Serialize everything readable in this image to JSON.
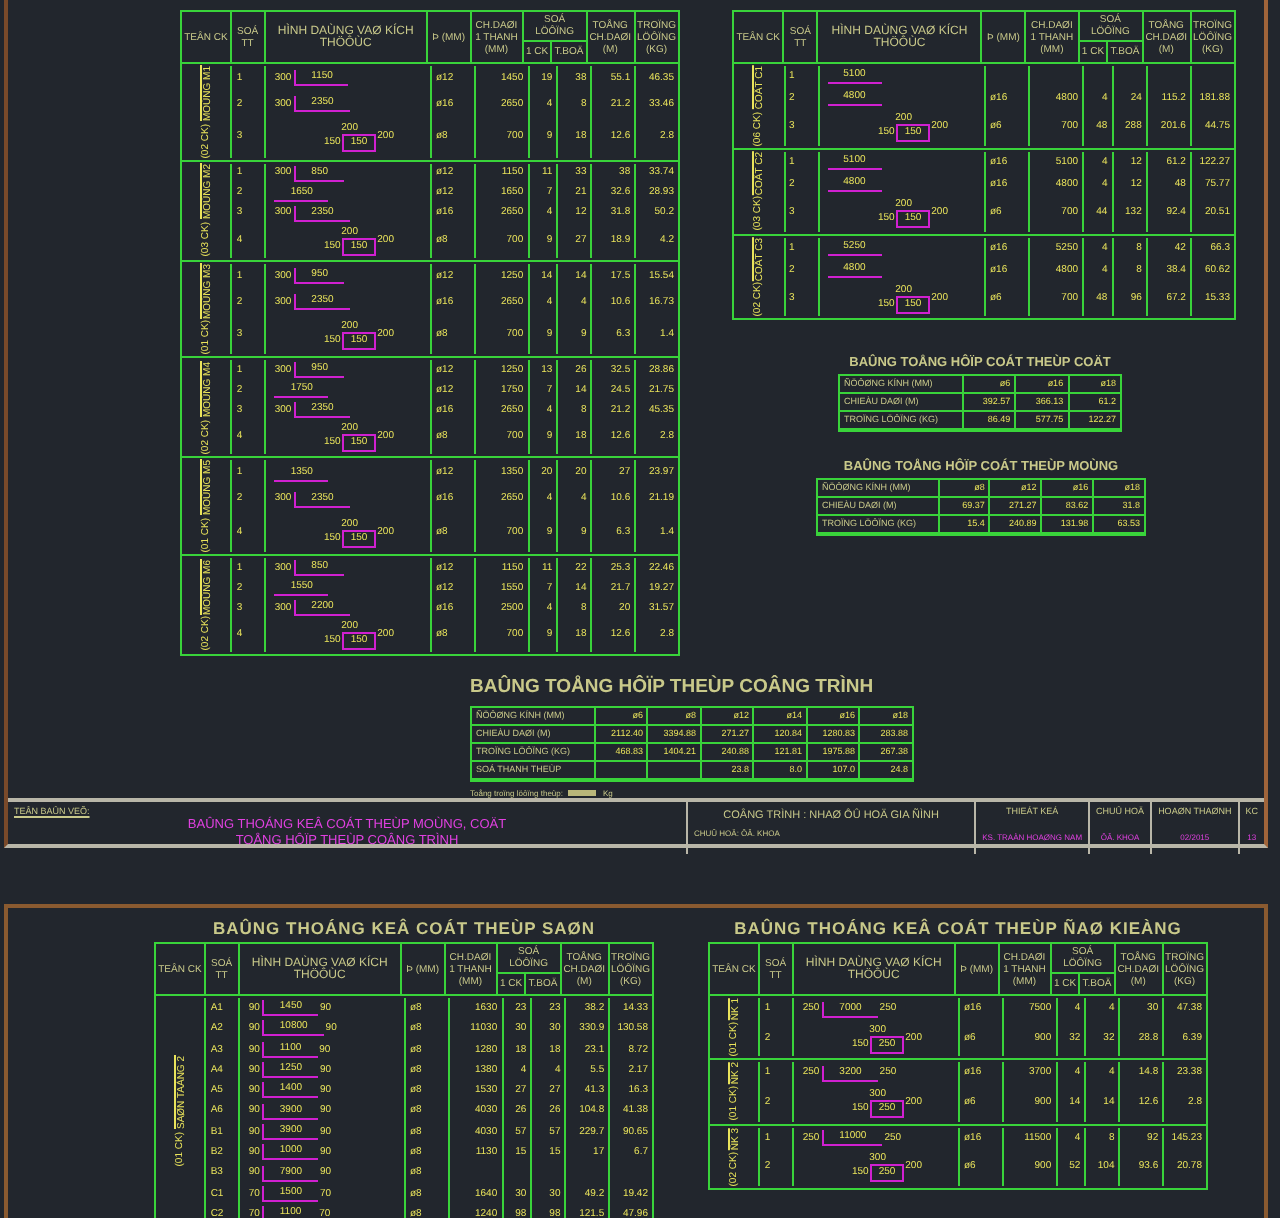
{
  "beam_schedule": {
    "header": {
      "name": "TEÂN CK",
      "no": "SOÁ TT",
      "shape": "HÌNH DAÙNG VAØ KÍCH THÖÔÙC",
      "dia": "Þ (MM)",
      "length": "CH.DAØI 1 THANH (MM)",
      "qty": "SOÁ LÖÔÏNG",
      "qty_each": "1 CK",
      "qty_total": "T.BOÄ",
      "total_length": "TOÅNG CH.DAØI (M)",
      "weight": "TROÏNG LÖÔÏNG (KG)"
    },
    "groups": [
      {
        "name": "MOÙNG M1",
        "count": "(02 CK)",
        "rows": [
          {
            "no": "1",
            "kind": "bar",
            "dims": [
              "300",
              "1150"
            ],
            "dia": "ø12",
            "length": "1450",
            "qty_each": "19",
            "qty_total": "38",
            "total_length": "55.1",
            "weight": "46.35"
          },
          {
            "no": "2",
            "kind": "bar",
            "dims": [
              "300",
              "2350"
            ],
            "dia": "ø16",
            "length": "2650",
            "qty_each": "4",
            "qty_total": "8",
            "total_length": "21.2",
            "weight": "33.46"
          },
          {
            "no": "3",
            "kind": "stirrup",
            "dims": [
              "200",
              "150",
              "150",
              "200"
            ],
            "dia": "ø8",
            "length": "700",
            "qty_each": "9",
            "qty_total": "18",
            "total_length": "12.6",
            "weight": "2.8"
          }
        ]
      },
      {
        "name": "MOÙNG M2",
        "count": "(03 CK)",
        "rows": [
          {
            "no": "1",
            "kind": "bar",
            "dims": [
              "300",
              "850"
            ],
            "dia": "ø12",
            "length": "1150",
            "qty_each": "11",
            "qty_total": "33",
            "total_length": "38",
            "weight": "33.74"
          },
          {
            "no": "2",
            "kind": "bar",
            "dims": [
              "1650"
            ],
            "dia": "ø12",
            "length": "1650",
            "qty_each": "7",
            "qty_total": "21",
            "total_length": "32.6",
            "weight": "28.93"
          },
          {
            "no": "3",
            "kind": "bar",
            "dims": [
              "300",
              "2350"
            ],
            "dia": "ø16",
            "length": "2650",
            "qty_each": "4",
            "qty_total": "12",
            "total_length": "31.8",
            "weight": "50.2"
          },
          {
            "no": "4",
            "kind": "stirrup",
            "dims": [
              "200",
              "150",
              "150",
              "200"
            ],
            "dia": "ø8",
            "length": "700",
            "qty_each": "9",
            "qty_total": "27",
            "total_length": "18.9",
            "weight": "4.2"
          }
        ]
      },
      {
        "name": "MOÙNG M3",
        "count": "(01 CK)",
        "rows": [
          {
            "no": "1",
            "kind": "bar",
            "dims": [
              "300",
              "950"
            ],
            "dia": "ø12",
            "length": "1250",
            "qty_each": "14",
            "qty_total": "14",
            "total_length": "17.5",
            "weight": "15.54"
          },
          {
            "no": "2",
            "kind": "bar",
            "dims": [
              "300",
              "2350"
            ],
            "dia": "ø16",
            "length": "2650",
            "qty_each": "4",
            "qty_total": "4",
            "total_length": "10.6",
            "weight": "16.73"
          },
          {
            "no": "3",
            "kind": "stirrup",
            "dims": [
              "200",
              "150",
              "150",
              "200"
            ],
            "dia": "ø8",
            "length": "700",
            "qty_each": "9",
            "qty_total": "9",
            "total_length": "6.3",
            "weight": "1.4"
          }
        ]
      },
      {
        "name": "MOÙNG M4",
        "count": "(02 CK)",
        "rows": [
          {
            "no": "1",
            "kind": "bar",
            "dims": [
              "300",
              "950"
            ],
            "dia": "ø12",
            "length": "1250",
            "qty_each": "13",
            "qty_total": "26",
            "total_length": "32.5",
            "weight": "28.86"
          },
          {
            "no": "2",
            "kind": "bar",
            "dims": [
              "1750"
            ],
            "dia": "ø12",
            "length": "1750",
            "qty_each": "7",
            "qty_total": "14",
            "total_length": "24.5",
            "weight": "21.75"
          },
          {
            "no": "3",
            "kind": "bar",
            "dims": [
              "300",
              "2350"
            ],
            "dia": "ø16",
            "length": "2650",
            "qty_each": "4",
            "qty_total": "8",
            "total_length": "21.2",
            "weight": "45.35"
          },
          {
            "no": "4",
            "kind": "stirrup",
            "dims": [
              "200",
              "150",
              "150",
              "200"
            ],
            "dia": "ø8",
            "length": "700",
            "qty_each": "9",
            "qty_total": "18",
            "total_length": "12.6",
            "weight": "2.8"
          }
        ]
      },
      {
        "name": "MOÙNG M5",
        "count": "(01 CK)",
        "rows": [
          {
            "no": "1",
            "kind": "bar",
            "dims": [
              "1350"
            ],
            "dia": "ø12",
            "length": "1350",
            "qty_each": "20",
            "qty_total": "20",
            "total_length": "27",
            "weight": "23.97"
          },
          {
            "no": "2",
            "kind": "bar",
            "dims": [
              "300",
              "2350"
            ],
            "dia": "ø16",
            "length": "2650",
            "qty_each": "4",
            "qty_total": "4",
            "total_length": "10.6",
            "weight": "21.19"
          },
          {
            "no": "4",
            "kind": "stirrup",
            "dims": [
              "200",
              "150",
              "150",
              "200"
            ],
            "dia": "ø8",
            "length": "700",
            "qty_each": "9",
            "qty_total": "9",
            "total_length": "6.3",
            "weight": "1.4"
          }
        ]
      },
      {
        "name": "MOÙNG M6",
        "count": "(02 CK)",
        "rows": [
          {
            "no": "1",
            "kind": "bar",
            "dims": [
              "300",
              "850"
            ],
            "dia": "ø12",
            "length": "1150",
            "qty_each": "11",
            "qty_total": "22",
            "total_length": "25.3",
            "weight": "22.46"
          },
          {
            "no": "2",
            "kind": "bar",
            "dims": [
              "1550"
            ],
            "dia": "ø12",
            "length": "1550",
            "qty_each": "7",
            "qty_total": "14",
            "total_length": "21.7",
            "weight": "19.27"
          },
          {
            "no": "3",
            "kind": "bar",
            "dims": [
              "300",
              "2200"
            ],
            "dia": "ø16",
            "length": "2500",
            "qty_each": "4",
            "qty_total": "8",
            "total_length": "20",
            "weight": "31.57"
          },
          {
            "no": "4",
            "kind": "stirrup",
            "dims": [
              "200",
              "150",
              "150",
              "200"
            ],
            "dia": "ø8",
            "length": "700",
            "qty_each": "9",
            "qty_total": "18",
            "total_length": "12.6",
            "weight": "2.8"
          }
        ]
      }
    ]
  },
  "column_schedule": {
    "header": {
      "name": "TEÂN CK",
      "no": "SOÁ TT",
      "shape": "HÌNH DAÙNG VAØ KÍCH THÖÔÙC",
      "dia": "Þ (MM)",
      "length": "CH.DAØI 1 THANH (MM)",
      "qty": "SOÁ LÖÔÏNG",
      "qty_each": "1 CK",
      "qty_total": "T.BOÄ",
      "total_length": "TOÅNG CH.DAØI (M)",
      "weight": "TROÏNG LÖÔÏNG (KG)"
    },
    "groups": [
      {
        "name": "COÄT C1",
        "count": "(06 CK)",
        "rows": [
          {
            "no": "1",
            "kind": "bar",
            "dims": [
              "5100"
            ]
          },
          {
            "no": "2",
            "kind": "bar",
            "dims": [
              "4800"
            ],
            "dia": "ø16",
            "length": "4800",
            "qty_each": "4",
            "qty_total": "24",
            "total_length": "115.2",
            "weight": "181.88"
          },
          {
            "no": "3",
            "kind": "stirrup",
            "dims": [
              "200",
              "150",
              "150",
              "200"
            ],
            "dia": "ø6",
            "length": "700",
            "qty_each": "48",
            "qty_total": "288",
            "total_length": "201.6",
            "weight": "44.75"
          }
        ]
      },
      {
        "name": "COÄT C2",
        "count": "(03 CK)",
        "rows": [
          {
            "no": "1",
            "kind": "bar",
            "dims": [
              "5100"
            ],
            "dia": "ø16",
            "length": "5100",
            "qty_each": "4",
            "qty_total": "12",
            "total_length": "61.2",
            "weight": "122.27"
          },
          {
            "no": "2",
            "kind": "bar",
            "dims": [
              "4800"
            ],
            "dia": "ø16",
            "length": "4800",
            "qty_each": "4",
            "qty_total": "12",
            "total_length": "48",
            "weight": "75.77"
          },
          {
            "no": "3",
            "kind": "stirrup",
            "dims": [
              "200",
              "150",
              "150",
              "200"
            ],
            "dia": "ø6",
            "length": "700",
            "qty_each": "44",
            "qty_total": "132",
            "total_length": "92.4",
            "weight": "20.51"
          }
        ]
      },
      {
        "name": "COÄT C3",
        "count": "(02 CK)",
        "rows": [
          {
            "no": "1",
            "kind": "bar",
            "dims": [
              "5250"
            ],
            "dia": "ø16",
            "length": "5250",
            "qty_each": "4",
            "qty_total": "8",
            "total_length": "42",
            "weight": "66.3"
          },
          {
            "no": "2",
            "kind": "bar",
            "dims": [
              "4800"
            ],
            "dia": "ø16",
            "length": "4800",
            "qty_each": "4",
            "qty_total": "8",
            "total_length": "38.4",
            "weight": "60.62"
          },
          {
            "no": "3",
            "kind": "stirrup",
            "dims": [
              "200",
              "150",
              "150",
              "200"
            ],
            "dia": "ø6",
            "length": "700",
            "qty_each": "48",
            "qty_total": "96",
            "total_length": "67.2",
            "weight": "15.33"
          }
        ]
      }
    ]
  },
  "column_summary": {
    "title": "BAÛNG TOÅNG HÔÏP COÁT THEÙP COÄT",
    "rows": [
      {
        "label": "ÑÖÔØNG KÍNH (MM)",
        "cells": [
          "ø6",
          "ø16",
          "ø18"
        ]
      },
      {
        "label": "CHIEÀU DAØI (M)",
        "cells": [
          "392.57",
          "366.13",
          "61.2"
        ]
      },
      {
        "label": "TROÏNG LÖÔÏNG (KG)",
        "cells": [
          "86.49",
          "577.75",
          "122.27"
        ]
      }
    ]
  },
  "foundation_summary": {
    "title": "BAÛNG TOÅNG HÔÏP COÁT THEÙP MOÙNG",
    "rows": [
      {
        "label": "ÑÖÔØNG KÍNH (MM)",
        "cells": [
          "ø8",
          "ø12",
          "ø16",
          "ø18"
        ]
      },
      {
        "label": "CHIEÀU DAØI (M)",
        "cells": [
          "69.37",
          "271.27",
          "83.62",
          "31.8"
        ]
      },
      {
        "label": "TROÏNG LÖÔÏNG (KG)",
        "cells": [
          "15.4",
          "240.89",
          "131.98",
          "63.53"
        ]
      }
    ]
  },
  "project_summary": {
    "title": "BAÛNG TOÅNG HÔÏP THEÙP COÂNG TRÌNH",
    "rows": [
      {
        "label": "ÑÖÔØNG KÍNH (MM)",
        "cells": [
          "ø6",
          "ø8",
          "ø12",
          "ø14",
          "ø16",
          "ø18"
        ]
      },
      {
        "label": "CHIEÀU DAØI (M)",
        "cells": [
          "2112.40",
          "3394.88",
          "271.27",
          "120.84",
          "1280.83",
          "283.88"
        ]
      },
      {
        "label": "TROÏNG LÖÔÏNG (KG)",
        "cells": [
          "468.83",
          "1404.21",
          "240.88",
          "121.81",
          "1975.88",
          "267.38"
        ]
      },
      {
        "label": "SOÁ THANH THEÙP",
        "cells": [
          "",
          "",
          "23.8",
          "8.0",
          "107.0",
          "24.8"
        ]
      }
    ],
    "note": "Toång troïng löôïng theùp:",
    "unit": "Kg"
  },
  "title_block": {
    "label": "TEÂN BAÛN VEÕ:",
    "title_lines": [
      "BAÛNG THOÁNG KEÂ COÁT THEÙP MOÙNG, COÄT",
      "TOÅNG HÔÏP THEÙP COÂNG TRÌNH"
    ],
    "project": "COÂNG TRÌNH : NHAØ ÔÛ HOÄ GIA ÑÌNH",
    "owner": "CHUÛ HOÄ: ÔÂ. KHOA",
    "fields": [
      {
        "heading": "THIEÁT KEÁ",
        "value": "KS. TRAÀN HOAØNG NAM"
      },
      {
        "heading": "CHUÛ HOÄ",
        "value": "ÔÂ. KHOA"
      },
      {
        "heading": "HOAØN THAØNH",
        "value": "02/2015"
      },
      {
        "heading": "KC",
        "value": "13"
      }
    ]
  },
  "slab_schedule": {
    "title": "BAÛNG THOÁNG KEÂ COÁT THEÙP SAØN",
    "header": {
      "name": "TEÂN CK",
      "no": "SOÁ TT",
      "shape": "HÌNH DAÙNG VAØ KÍCH THÖÔÙC",
      "dia": "Þ (MM)",
      "length": "CH.DAØI 1 THANH (MM)",
      "qty": "SOÁ LÖÔÏNG",
      "qty_each": "1 CK",
      "qty_total": "T.BOÄ",
      "total_length": "TOÅNG CH.DAØI (M)",
      "weight": "TROÏNG LÖÔÏNG (KG)"
    },
    "groups": [
      {
        "name": "SAØN TAÀNG 2",
        "count": "(01 CK)",
        "rows": [
          {
            "no": "A1",
            "kind": "bar",
            "dims": [
              "90",
              "1450",
              "90"
            ],
            "dia": "ø8",
            "length": "1630",
            "qty_each": "23",
            "qty_total": "23",
            "total_length": "38.2",
            "weight": "14.33"
          },
          {
            "no": "A2",
            "kind": "bar",
            "dims": [
              "90",
              "10800",
              "90"
            ],
            "dia": "ø8",
            "length": "11030",
            "qty_each": "30",
            "qty_total": "30",
            "total_length": "330.9",
            "weight": "130.58"
          },
          {
            "no": "A3",
            "kind": "bar",
            "dims": [
              "90",
              "1100",
              "90"
            ],
            "dia": "ø8",
            "length": "1280",
            "qty_each": "18",
            "qty_total": "18",
            "total_length": "23.1",
            "weight": "8.72"
          },
          {
            "no": "A4",
            "kind": "bar",
            "dims": [
              "90",
              "1250",
              "90"
            ],
            "dia": "ø8",
            "length": "1380",
            "qty_each": "4",
            "qty_total": "4",
            "total_length": "5.5",
            "weight": "2.17"
          },
          {
            "no": "A5",
            "kind": "bar",
            "dims": [
              "90",
              "1400",
              "90"
            ],
            "dia": "ø8",
            "length": "1530",
            "qty_each": "27",
            "qty_total": "27",
            "total_length": "41.3",
            "weight": "16.3"
          },
          {
            "no": "A6",
            "kind": "bar",
            "dims": [
              "90",
              "3900",
              "90"
            ],
            "dia": "ø8",
            "length": "4030",
            "qty_each": "26",
            "qty_total": "26",
            "total_length": "104.8",
            "weight": "41.38"
          },
          {
            "no": "B1",
            "kind": "bar",
            "dims": [
              "90",
              "3900",
              "90"
            ],
            "dia": "ø8",
            "length": "4030",
            "qty_each": "57",
            "qty_total": "57",
            "total_length": "229.7",
            "weight": "90.65"
          },
          {
            "no": "B2",
            "kind": "bar",
            "dims": [
              "90",
              "1000",
              "90"
            ],
            "dia": "ø8",
            "length": "1130",
            "qty_each": "15",
            "qty_total": "15",
            "total_length": "17",
            "weight": "6.7"
          },
          {
            "no": "B3",
            "kind": "bar",
            "dims": [
              "90",
              "7900",
              "90"
            ],
            "dia": "ø8"
          },
          {
            "no": "C1",
            "kind": "bar",
            "dims": [
              "70",
              "1500",
              "70"
            ],
            "dia": "ø8",
            "length": "1640",
            "qty_each": "30",
            "qty_total": "30",
            "total_length": "49.2",
            "weight": "19.42"
          },
          {
            "no": "C2",
            "kind": "bar",
            "dims": [
              "70",
              "1100",
              "70"
            ],
            "dia": "ø8",
            "length": "1240",
            "qty_each": "98",
            "qty_total": "98",
            "total_length": "121.5",
            "weight": "47.96"
          }
        ]
      }
    ]
  },
  "tie_beam_schedule": {
    "title": "BAÛNG THOÁNG KEÂ COÁT THEÙP ÑAØ KIEÀNG",
    "header": {
      "name": "TEÂN CK",
      "no": "SOÁ TT",
      "shape": "HÌNH DAÙNG VAØ KÍCH THÖÔÙC",
      "dia": "Þ (MM)",
      "length": "CH.DAØI 1 THANH (MM)",
      "qty": "SOÁ LÖÔÏNG",
      "qty_each": "1 CK",
      "qty_total": "T.BOÄ",
      "total_length": "TOÅNG CH.DAØI (M)",
      "weight": "TROÏNG LÖÔÏNG (KG)"
    },
    "groups": [
      {
        "name": "ÑK 1",
        "count": "(01 CK)",
        "rows": [
          {
            "no": "1",
            "kind": "bar",
            "dims": [
              "250",
              "7000",
              "250"
            ],
            "dia": "ø16",
            "length": "7500",
            "qty_each": "4",
            "qty_total": "4",
            "total_length": "30",
            "weight": "47.38"
          },
          {
            "no": "2",
            "kind": "stirrup",
            "dims": [
              "300",
              "150",
              "250",
              "200"
            ],
            "dia": "ø6",
            "length": "900",
            "qty_each": "32",
            "qty_total": "32",
            "total_length": "28.8",
            "weight": "6.39"
          }
        ]
      },
      {
        "name": "ÑK 2",
        "count": "(01 CK)",
        "rows": [
          {
            "no": "1",
            "kind": "bar",
            "dims": [
              "250",
              "3200",
              "250"
            ],
            "dia": "ø16",
            "length": "3700",
            "qty_each": "4",
            "qty_total": "4",
            "total_length": "14.8",
            "weight": "23.38"
          },
          {
            "no": "2",
            "kind": "stirrup",
            "dims": [
              "300",
              "150",
              "250",
              "200"
            ],
            "dia": "ø6",
            "length": "900",
            "qty_each": "14",
            "qty_total": "14",
            "total_length": "12.6",
            "weight": "2.8"
          }
        ]
      },
      {
        "name": "ÑK 3",
        "count": "(02 CK)",
        "rows": [
          {
            "no": "1",
            "kind": "bar",
            "dims": [
              "250",
              "11000",
              "250"
            ],
            "dia": "ø16",
            "length": "11500",
            "qty_each": "4",
            "qty_total": "8",
            "total_length": "92",
            "weight": "145.23"
          },
          {
            "no": "2",
            "kind": "stirrup",
            "dims": [
              "300",
              "150",
              "250",
              "200"
            ],
            "dia": "ø6",
            "length": "900",
            "qty_each": "52",
            "qty_total": "104",
            "total_length": "93.6",
            "weight": "20.78"
          }
        ]
      }
    ]
  }
}
